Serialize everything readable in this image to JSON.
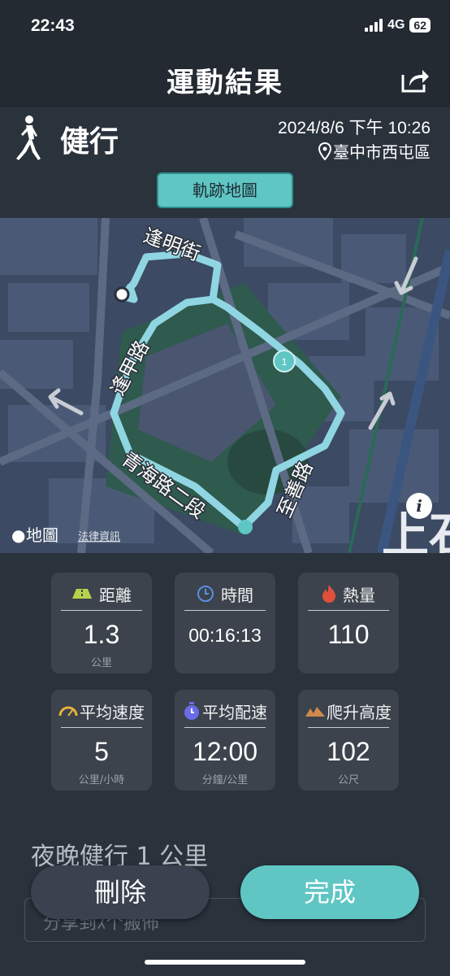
{
  "status_bar": {
    "time": "22:43",
    "network": "4G",
    "battery": "62"
  },
  "nav": {
    "title": "運動結果",
    "share_icon": "share-icon"
  },
  "activity": {
    "name": "健行",
    "datetime": "2024/8/6 下午 10:26",
    "location": "臺中市西屯區"
  },
  "map_button": {
    "label": "軌跡地圖"
  },
  "map": {
    "streets": {
      "s1": "逢明街",
      "s2": "逢甲路",
      "s3": "青海路二段",
      "s4": "至善路",
      "s5": "上石"
    },
    "marker_label": "1",
    "logo": "地圖",
    "legal": "法律資訊",
    "info_icon": "info-icon",
    "route_color": "#8fd6e2",
    "accent": "#5fc6c4"
  },
  "stats": [
    {
      "label": "距離",
      "value": "1.3",
      "unit": "公里",
      "icon": "road-icon"
    },
    {
      "label": "時間",
      "value": "00:16:13",
      "unit": "",
      "icon": "clock-icon"
    },
    {
      "label": "熱量",
      "value": "110",
      "unit": "",
      "icon": "flame-icon"
    },
    {
      "label": "平均速度",
      "value": "5",
      "unit": "公里/小時",
      "icon": "speedometer-icon"
    },
    {
      "label": "平均配速",
      "value": "12:00",
      "unit": "分鐘/公里",
      "icon": "stopwatch-icon"
    },
    {
      "label": "爬升高度",
      "value": "102",
      "unit": "公尺",
      "icon": "mountain-icon"
    }
  ],
  "note": {
    "title": "夜晚健行 1 公里",
    "share_text": "分享到ｽ个搬佈"
  },
  "buttons": {
    "delete": "刪除",
    "done": "完成"
  }
}
